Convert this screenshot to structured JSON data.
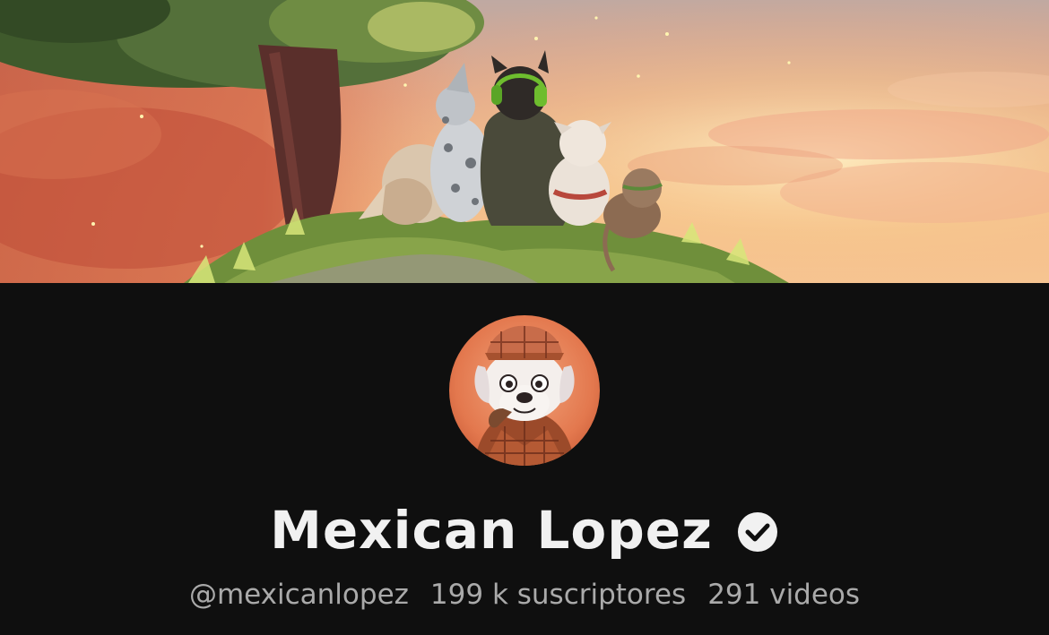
{
  "channel": {
    "name": "Mexican Lopez",
    "handle": "@mexicanlopez",
    "subscribers": "199 k suscriptores",
    "videos": "291 videos",
    "verified": true
  },
  "banner": {
    "icon": "channel-banner-artwork"
  },
  "avatar": {
    "icon": "dog-detective-avatar"
  },
  "colors": {
    "background": "#0f0f0f",
    "title_text": "#f1f1f1",
    "meta_text": "#aaaaaa",
    "verified_badge": "#f1f1f1"
  }
}
